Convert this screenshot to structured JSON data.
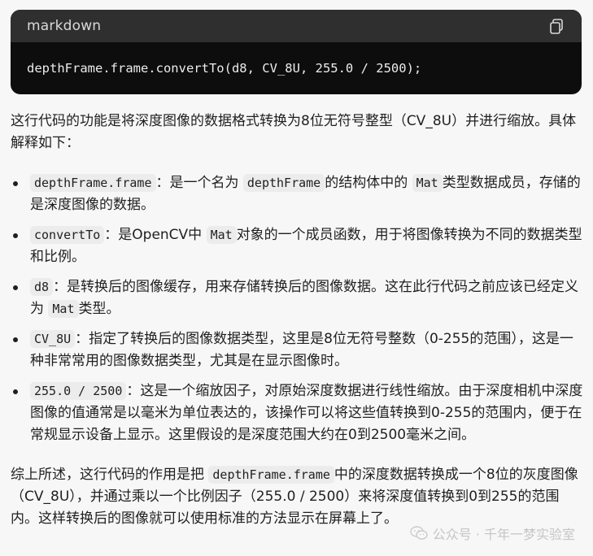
{
  "code_block": {
    "language": "markdown",
    "code": "depthFrame.frame.convertTo(d8, CV_8U, 255.0 / 2500);"
  },
  "intro": "这行代码的功能是将深度图像的数据格式转换为8位无符号整型（CV_8U）并进行缩放。具体解释如下：",
  "bullets": [
    {
      "code": "depthFrame.frame",
      "t1": "：是一个名为",
      "c2": "depthFrame",
      "t2": "的结构体中的",
      "c3": "Mat",
      "t3": "类型数据成员，存储的是深度图像的数据。"
    },
    {
      "code": "convertTo",
      "t1": "：是OpenCV中",
      "c2": "Mat",
      "t2": "对象的一个成员函数，用于将图像转换为不同的数据类型和比例。"
    },
    {
      "code": "d8",
      "t1": "：是转换后的图像缓存，用来存储转换后的图像数据。这在此行代码之前应该已经定义为",
      "c2": "Mat",
      "t2": "类型。"
    },
    {
      "code": "CV_8U",
      "t1": "：指定了转换后的图像数据类型，这里是8位无符号整数（0-255的范围），这是一种非常常用的图像数据类型，尤其是在显示图像时。"
    },
    {
      "code": "255.0 / 2500",
      "t1": "：这是一个缩放因子，对原始深度数据进行线性缩放。由于深度相机中深度图像的值通常是以毫米为单位表达的，该操作可以将这些值转换到0-255的范围内，便于在常规显示设备上显示。这里假设的是深度范围大约在0到2500毫米之间。"
    }
  ],
  "summary": {
    "t1": "综上所述，这行代码的作用是把",
    "code": "depthFrame.frame",
    "t2": "中的深度数据转换成一个8位的灰度图像（CV_8U），并通过乘以一个比例因子（255.0 / 2500）来将深度值转换到0到255的范围内。这样转换后的图像就可以使用标准的方法显示在屏幕上了。"
  },
  "watermark": "公众号 · 千年一梦实验室",
  "icons": {
    "copy": "copy-icon",
    "watermark": "wechat-icon"
  }
}
